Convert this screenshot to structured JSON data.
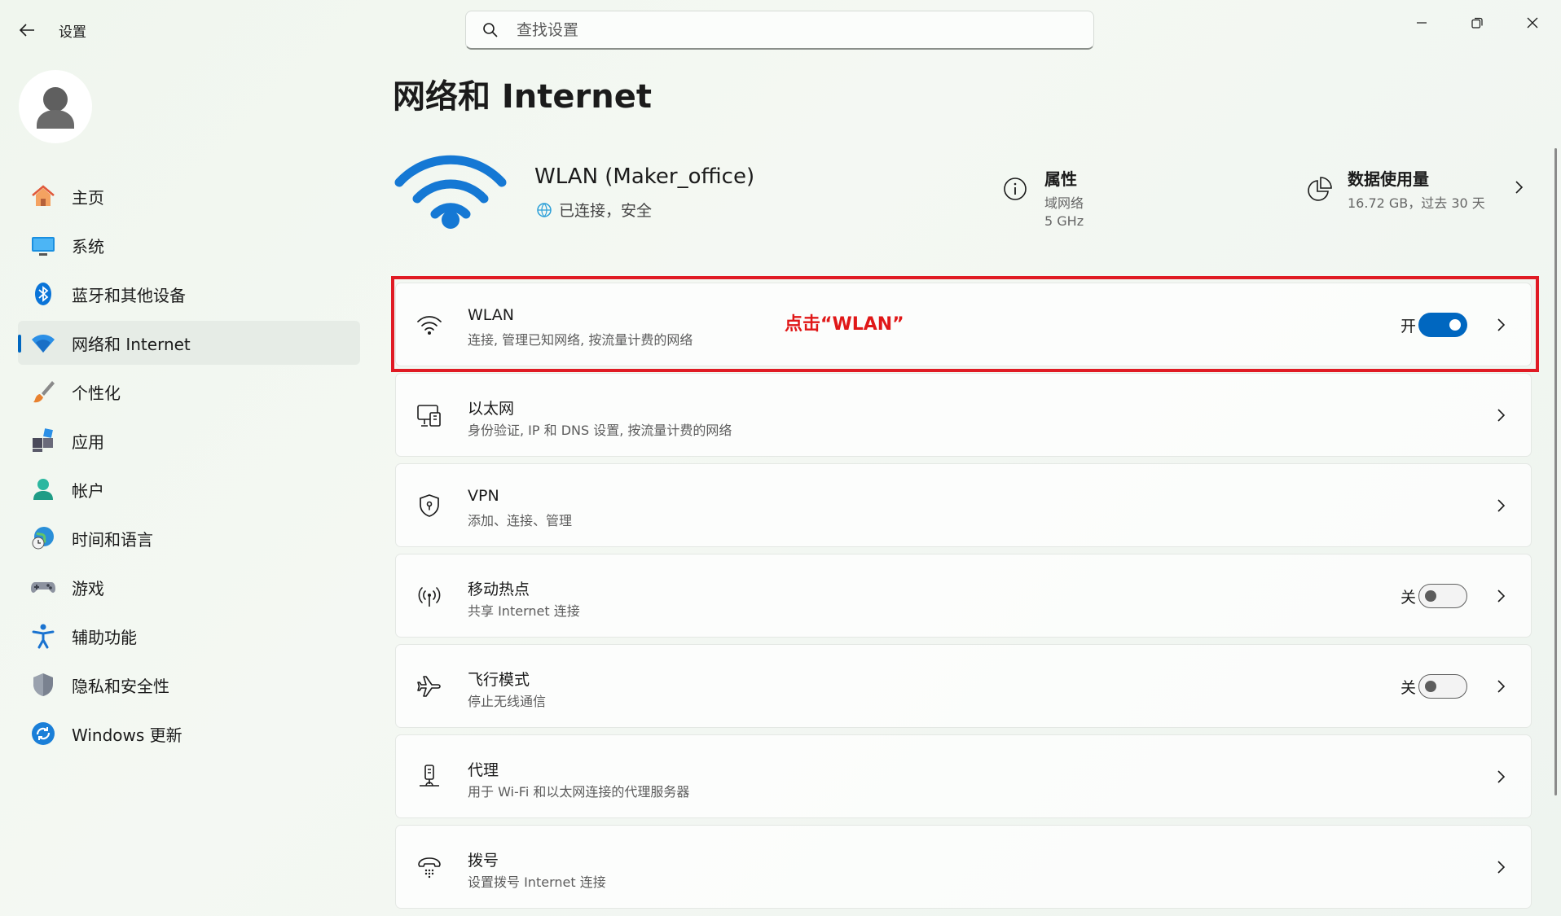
{
  "app": {
    "title": "设置"
  },
  "search": {
    "placeholder": "查找设置"
  },
  "sidebar": {
    "items": [
      {
        "label": "主页",
        "icon": "home-icon"
      },
      {
        "label": "系统",
        "icon": "monitor-icon"
      },
      {
        "label": "蓝牙和其他设备",
        "icon": "bluetooth-icon"
      },
      {
        "label": "网络和 Internet",
        "icon": "wifi-icon",
        "active": true
      },
      {
        "label": "个性化",
        "icon": "brush-icon"
      },
      {
        "label": "应用",
        "icon": "apps-icon"
      },
      {
        "label": "帐户",
        "icon": "account-icon"
      },
      {
        "label": "时间和语言",
        "icon": "globe-clock-icon"
      },
      {
        "label": "游戏",
        "icon": "gamepad-icon"
      },
      {
        "label": "辅助功能",
        "icon": "accessibility-icon"
      },
      {
        "label": "隐私和安全性",
        "icon": "shield-icon"
      },
      {
        "label": "Windows 更新",
        "icon": "update-icon"
      }
    ]
  },
  "main": {
    "title": "网络和 Internet",
    "hero": {
      "network_name": "WLAN (Maker_office)",
      "status": "已连接，安全",
      "properties": {
        "title": "属性",
        "line1": "域网络",
        "line2": "5 GHz"
      },
      "usage": {
        "title": "数据使用量",
        "detail": "16.72 GB，过去 30 天"
      }
    },
    "annotation": "点击“WLAN”",
    "cards": [
      {
        "title": "WLAN",
        "subtitle": "连接, 管理已知网络, 按流量计费的网络",
        "icon": "wifi-icon",
        "toggle_label": "开",
        "toggle": "on"
      },
      {
        "title": "以太网",
        "subtitle": "身份验证, IP 和 DNS 设置, 按流量计费的网络",
        "icon": "ethernet-icon"
      },
      {
        "title": "VPN",
        "subtitle": "添加、连接、管理",
        "icon": "vpn-shield-icon"
      },
      {
        "title": "移动热点",
        "subtitle": "共享 Internet 连接",
        "icon": "hotspot-icon",
        "toggle_label": "关",
        "toggle": "off"
      },
      {
        "title": "飞行模式",
        "subtitle": "停止无线通信",
        "icon": "airplane-icon",
        "toggle_label": "关",
        "toggle": "off"
      },
      {
        "title": "代理",
        "subtitle": "用于 Wi-Fi 和以太网连接的代理服务器",
        "icon": "proxy-icon"
      },
      {
        "title": "拨号",
        "subtitle": "设置拨号 Internet 连接",
        "icon": "dialup-icon"
      }
    ]
  },
  "colors": {
    "accent": "#0067c0",
    "annotation": "#e01818"
  }
}
